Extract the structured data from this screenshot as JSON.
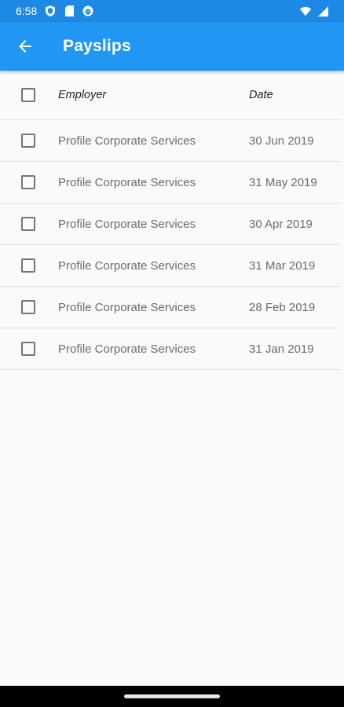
{
  "status_bar": {
    "time": "6:58",
    "icons_left": [
      "shield-icon",
      "sim-card-icon",
      "face-icon"
    ],
    "icons_right": [
      "wifi-icon",
      "signal-icon"
    ],
    "color": "#1e88e5"
  },
  "app_bar": {
    "title": "Payslips",
    "back_icon": "arrow-left-icon",
    "color": "#2196f3"
  },
  "table": {
    "columns": {
      "employer": "Employer",
      "date": "Date"
    },
    "rows": [
      {
        "employer": "Profile Corporate Services",
        "date": "30 Jun 2019",
        "checked": false
      },
      {
        "employer": "Profile Corporate Services",
        "date": "31 May 2019",
        "checked": false
      },
      {
        "employer": "Profile Corporate Services",
        "date": "30 Apr 2019",
        "checked": false
      },
      {
        "employer": "Profile Corporate Services",
        "date": "31 Mar 2019",
        "checked": false
      },
      {
        "employer": "Profile Corporate Services",
        "date": "28 Feb 2019",
        "checked": false
      },
      {
        "employer": "Profile Corporate Services",
        "date": "31 Jan 2019",
        "checked": false
      }
    ]
  }
}
